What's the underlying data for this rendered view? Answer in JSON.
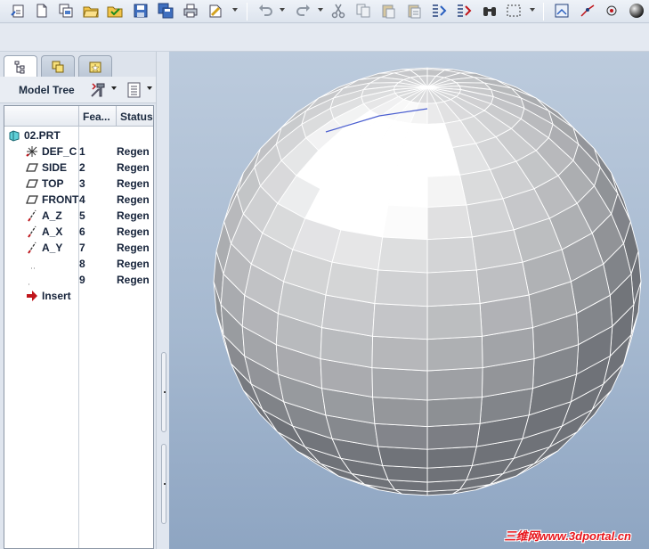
{
  "panel": {
    "title": "Model Tree",
    "columns": [
      "Fea...",
      "Status"
    ],
    "tabs": [
      "model-tree-tab-icon",
      "layer-tab-icon",
      "favorites-tab-icon"
    ]
  },
  "tree": {
    "root": "02.PRT",
    "items": [
      {
        "name": "DEF_C",
        "number": "1",
        "status": "Regen",
        "icon": "coordinate-system-icon"
      },
      {
        "name": "SIDE",
        "number": "2",
        "status": "Regen",
        "icon": "datum-plane-icon"
      },
      {
        "name": "TOP",
        "number": "3",
        "status": "Regen",
        "icon": "datum-plane-icon"
      },
      {
        "name": "FRONT",
        "number": "4",
        "status": "Regen",
        "icon": "datum-plane-icon"
      },
      {
        "name": "A_Z",
        "number": "5",
        "status": "Regen",
        "icon": "datum-axis-icon"
      },
      {
        "name": "A_X",
        "number": "6",
        "status": "Regen",
        "icon": "datum-axis-icon"
      },
      {
        "name": "A_Y",
        "number": "7",
        "status": "Regen",
        "icon": "datum-axis-icon"
      },
      {
        "name": "",
        "number": "8",
        "status": "Regen",
        "icon": ""
      },
      {
        "name": "",
        "number": "9",
        "status": "Regen",
        "icon": ""
      }
    ],
    "insert_label": "Insert"
  },
  "watermark": "三维网www.3dportal.cn",
  "colors": {
    "accent": "#1c2b40",
    "insert_arrow": "#c0161c",
    "watermark": "#e8141b"
  }
}
